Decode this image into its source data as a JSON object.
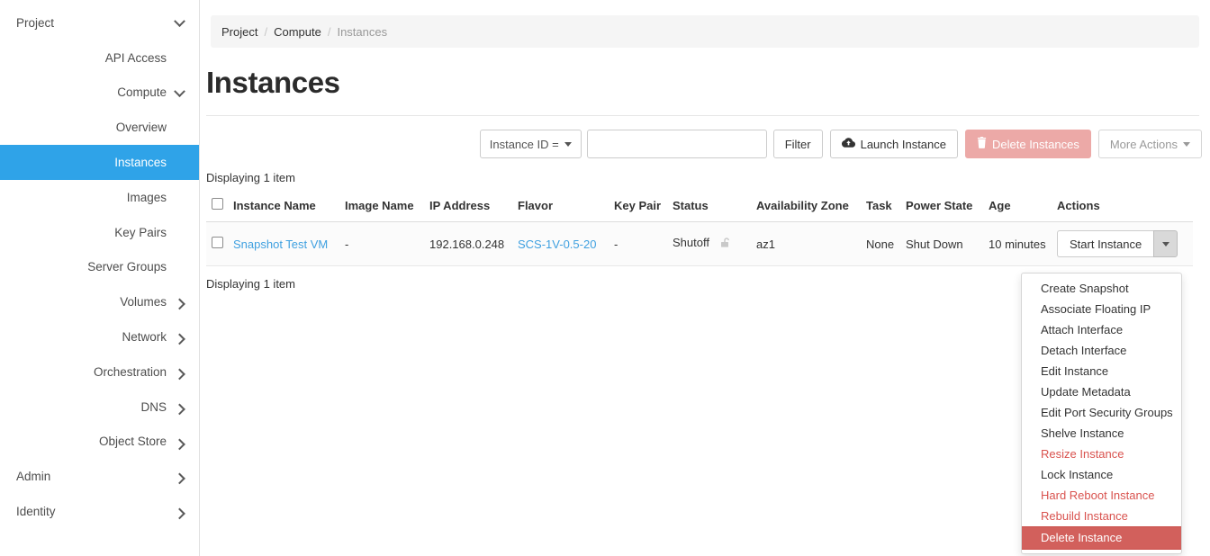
{
  "sidebar": {
    "items": [
      {
        "label": "Project",
        "level": "top",
        "icon": "chevron-down-icon",
        "active": false
      },
      {
        "label": "API Access",
        "level": "sub",
        "icon": "none",
        "active": false
      },
      {
        "label": "Compute",
        "level": "sub",
        "icon": "chevron-down-icon",
        "active": false
      },
      {
        "label": "Overview",
        "level": "sub2",
        "icon": "none",
        "active": false
      },
      {
        "label": "Instances",
        "level": "sub2",
        "icon": "none",
        "active": true
      },
      {
        "label": "Images",
        "level": "sub2",
        "icon": "none",
        "active": false
      },
      {
        "label": "Key Pairs",
        "level": "sub2",
        "icon": "none",
        "active": false
      },
      {
        "label": "Server Groups",
        "level": "sub2",
        "icon": "none",
        "active": false
      },
      {
        "label": "Volumes",
        "level": "sub",
        "icon": "chevron-right-icon",
        "active": false
      },
      {
        "label": "Network",
        "level": "sub",
        "icon": "chevron-right-icon",
        "active": false
      },
      {
        "label": "Orchestration",
        "level": "sub",
        "icon": "chevron-right-icon",
        "active": false
      },
      {
        "label": "DNS",
        "level": "sub",
        "icon": "chevron-right-icon",
        "active": false
      },
      {
        "label": "Object Store",
        "level": "sub",
        "icon": "chevron-right-icon",
        "active": false
      },
      {
        "label": "Admin",
        "level": "top",
        "icon": "chevron-right-icon",
        "active": false
      },
      {
        "label": "Identity",
        "level": "top",
        "icon": "chevron-right-icon",
        "active": false
      }
    ]
  },
  "breadcrumb": {
    "project": "Project",
    "compute": "Compute",
    "current": "Instances",
    "separator": "/"
  },
  "page": {
    "title": "Instances",
    "count_top": "Displaying 1 item",
    "count_bottom": "Displaying 1 item"
  },
  "toolbar": {
    "filter_type_label": "Instance ID =",
    "filter_input_value": "",
    "filter_input_placeholder": "",
    "filter_label": "Filter",
    "launch_label": "Launch Instance",
    "launch_icon": "cloud-upload-icon",
    "delete_label": "Delete Instances",
    "delete_icon": "trash-icon",
    "more_actions_label": "More Actions",
    "delete_button_color": "#eca9a7"
  },
  "table": {
    "headers": [
      "Instance Name",
      "Image Name",
      "IP Address",
      "Flavor",
      "Key Pair",
      "Status",
      "Availability Zone",
      "Task",
      "Power State",
      "Age",
      "Actions"
    ],
    "rows": [
      {
        "instance_name": "Snapshot Test VM",
        "image_name": "-",
        "ip_address": "192.168.0.248",
        "flavor": "SCS-1V-0.5-20",
        "key_pair": "-",
        "status": "Shutoff",
        "status_icon": "unlocked-padlock-icon",
        "availability_zone": "az1",
        "task": "None",
        "power_state": "Shut Down",
        "age": "10 minutes",
        "action_label": "Start Instance",
        "action_caret_icon": "caret-down-icon"
      }
    ]
  },
  "actions_menu": {
    "items": [
      {
        "label": "Create Snapshot",
        "style": "normal"
      },
      {
        "label": "Associate Floating IP",
        "style": "normal"
      },
      {
        "label": "Attach Interface",
        "style": "normal"
      },
      {
        "label": "Detach Interface",
        "style": "normal"
      },
      {
        "label": "Edit Instance",
        "style": "normal"
      },
      {
        "label": "Update Metadata",
        "style": "normal"
      },
      {
        "label": "Edit Port Security Groups",
        "style": "normal"
      },
      {
        "label": "Shelve Instance",
        "style": "normal"
      },
      {
        "label": "Resize Instance",
        "style": "danger"
      },
      {
        "label": "Lock Instance",
        "style": "normal"
      },
      {
        "label": "Hard Reboot Instance",
        "style": "danger"
      },
      {
        "label": "Rebuild Instance",
        "style": "danger"
      },
      {
        "label": "Delete Instance",
        "style": "active-danger"
      }
    ],
    "danger_color": "#d9534f",
    "highlight_color": "#d2605c"
  },
  "theme": {
    "accent": "#2fa3e8",
    "link": "#3fa0e0"
  }
}
